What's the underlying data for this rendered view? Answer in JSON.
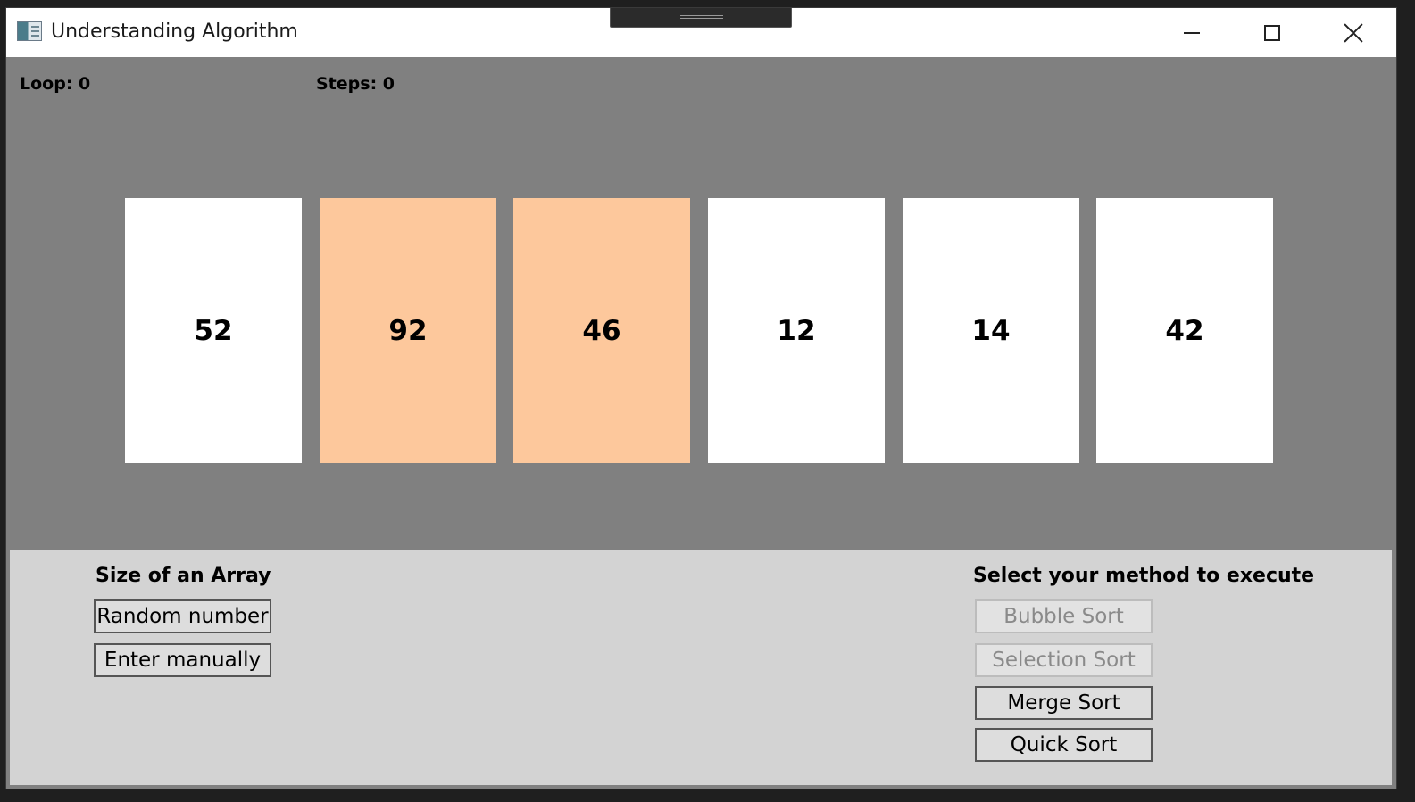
{
  "window": {
    "title": "Understanding Algorithm"
  },
  "stats": {
    "loop": "Loop: 0",
    "steps": "Steps: 0"
  },
  "array": {
    "cards": [
      {
        "value": "52",
        "highlighted": false
      },
      {
        "value": "92",
        "highlighted": true
      },
      {
        "value": "46",
        "highlighted": true
      },
      {
        "value": "12",
        "highlighted": false
      },
      {
        "value": "14",
        "highlighted": false
      },
      {
        "value": "42",
        "highlighted": false
      }
    ],
    "highlight_color": "#fdc89c",
    "card_color": "#ffffff"
  },
  "array_size": {
    "label": "Size of an Array",
    "random_button": "Random number",
    "manual_button": "Enter manually"
  },
  "methods": {
    "label": "Select your method to execute",
    "bubble_sort": "Bubble Sort",
    "selection_sort": "Selection Sort",
    "merge_sort": "Merge Sort",
    "quick_sort": "Quick Sort"
  },
  "icons": {
    "app": "app-window-icon",
    "minimize": "minimize-icon",
    "maximize": "maximize-icon",
    "close": "close-icon"
  }
}
